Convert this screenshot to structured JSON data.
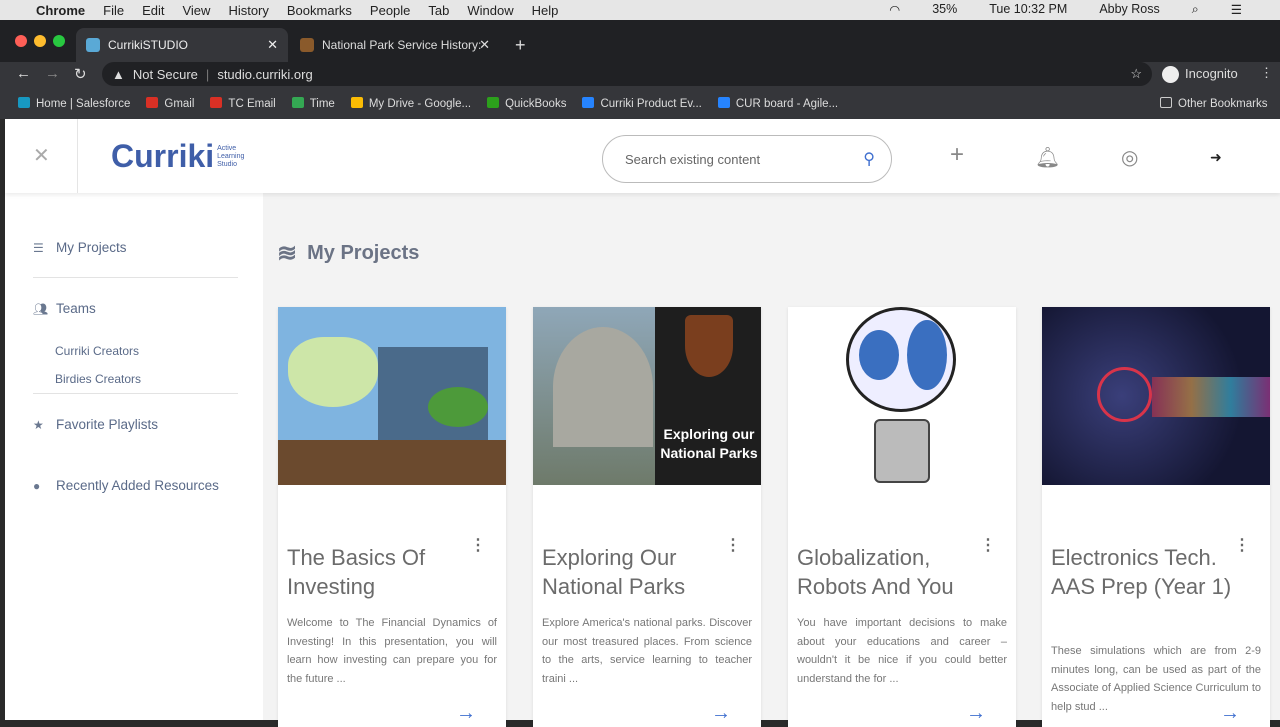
{
  "menubar": {
    "app": "Chrome",
    "items": [
      "File",
      "Edit",
      "View",
      "History",
      "Bookmarks",
      "People",
      "Tab",
      "Window",
      "Help"
    ],
    "battery": "35%",
    "clock": "Tue 10:32 PM",
    "user": "Abby Ross"
  },
  "tabs": [
    {
      "title": "CurrikiSTUDIO",
      "active": true
    },
    {
      "title": "National Park Service History:",
      "active": false
    }
  ],
  "address": {
    "security": "Not Secure",
    "url": "studio.curriki.org",
    "profile": "Incognito"
  },
  "bookmarks": [
    {
      "label": "Home | Salesforce",
      "color": "#1798c1"
    },
    {
      "label": "Gmail",
      "color": "#d93025"
    },
    {
      "label": "TC Email",
      "color": "#d93025"
    },
    {
      "label": "Time",
      "color": "#34a853"
    },
    {
      "label": "My Drive - Google...",
      "color": "#fbbc04"
    },
    {
      "label": "QuickBooks",
      "color": "#2ca01c"
    },
    {
      "label": "Curriki Product Ev...",
      "color": "#2684ff"
    },
    {
      "label": "CUR board - Agile...",
      "color": "#2684ff"
    }
  ],
  "other_bookmarks": "Other Bookmarks",
  "header": {
    "logo": "Curriki",
    "logo_sub": "Active Learning Studio",
    "search_placeholder": "Search existing content"
  },
  "sidebar": {
    "my_projects": "My Projects",
    "teams": "Teams",
    "team_items": [
      "Curriki Creators",
      "Birdies Creators"
    ],
    "favorites": "Favorite Playlists",
    "recent": "Recently Added Resources"
  },
  "main": {
    "title": "My Projects"
  },
  "projects": [
    {
      "title": "The Basics Of Investing",
      "desc": "Welcome to The Financial Dynamics of Investing! In this presentation, you will learn how investing can prepare you for the future ..."
    },
    {
      "title": "Exploring Our National Parks",
      "desc": "Explore America's national parks. Discover our most treasured places. From science to the arts, service learning to teacher traini ...",
      "image_text": "Exploring our National Parks"
    },
    {
      "title": "Globalization, Robots And You",
      "desc": "You have important decisions to make about your educations and career – wouldn't it be nice if you could better understand the for ..."
    },
    {
      "title": "Electronics Tech. AAS Prep (Year 1)",
      "desc": "These simulations which are from 2-9 minutes long, can be used as part of the Associate of Applied Science Curriculum to help stud ..."
    }
  ],
  "colors": {
    "accent": "#3f6fcf",
    "logo": "#3f5ea8"
  }
}
